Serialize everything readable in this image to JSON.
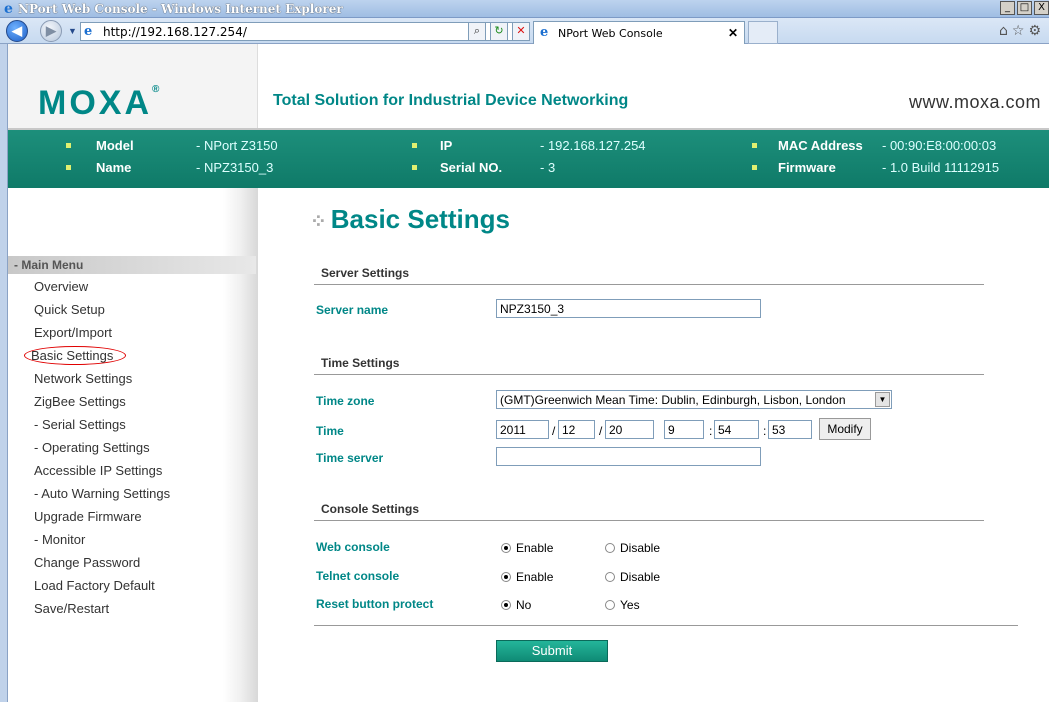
{
  "window": {
    "title": "NPort Web Console - Windows Internet Explorer",
    "url": "http://192.168.127.254/",
    "tab_label": "NPort Web Console",
    "minimize": "_",
    "maximize": "□",
    "close": "X"
  },
  "header": {
    "logo": "MOXA",
    "logo_mark": "®",
    "tagline": "Total Solution for Industrial Device Networking",
    "site": "www.moxa.com"
  },
  "info": {
    "model_label": "Model",
    "model_value": "- NPort Z3150",
    "name_label": "Name",
    "name_value": "- NPZ3150_3",
    "ip_label": "IP",
    "ip_value": "- 192.168.127.254",
    "serial_label": "Serial NO.",
    "serial_value": "- 3",
    "mac_label": "MAC Address",
    "mac_value": "- 00:90:E8:00:00:03",
    "firmware_label": "Firmware",
    "firmware_value": "- 1.0 Build 11112915"
  },
  "sidebar": {
    "menu_head": "- Main Menu",
    "items": [
      {
        "label": "Overview"
      },
      {
        "label": "Quick Setup"
      },
      {
        "label": "Export/Import"
      },
      {
        "label": "Basic Settings"
      },
      {
        "label": "Network Settings"
      },
      {
        "label": "ZigBee Settings"
      },
      {
        "label": "- Serial Settings"
      },
      {
        "label": "- Operating Settings"
      },
      {
        "label": "Accessible IP Settings"
      },
      {
        "label": "- Auto Warning Settings"
      },
      {
        "label": "Upgrade Firmware"
      },
      {
        "label": "- Monitor"
      },
      {
        "label": "Change Password"
      },
      {
        "label": "Load Factory Default"
      },
      {
        "label": "Save/Restart"
      }
    ]
  },
  "main": {
    "title": "Basic Settings",
    "server": {
      "heading": "Server Settings",
      "name_label": "Server name",
      "name_value": "NPZ3150_3"
    },
    "time": {
      "heading": "Time Settings",
      "zone_label": "Time zone",
      "zone_value": "(GMT)Greenwich Mean Time: Dublin, Edinburgh, Lisbon, London",
      "time_label": "Time",
      "year": "2011",
      "month": "12",
      "day": "20",
      "hour": "9",
      "minute": "54",
      "second": "53",
      "date_sep": "/",
      "time_sep": ":",
      "modify": "Modify",
      "server_label": "Time server",
      "server_value": ""
    },
    "console": {
      "heading": "Console Settings",
      "web_label": "Web console",
      "telnet_label": "Telnet console",
      "reset_label": "Reset button protect",
      "enable": "Enable",
      "disable": "Disable",
      "no": "No",
      "yes": "Yes"
    },
    "submit": "Submit"
  },
  "colors": {
    "brand_teal": "#008787",
    "infobar": "#0f7a68",
    "highlight_circle": "#e00000"
  }
}
